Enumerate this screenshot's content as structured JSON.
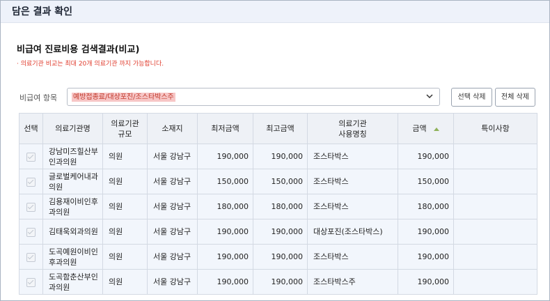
{
  "header": {
    "title": "담은 결과 확인"
  },
  "section": {
    "title": "비급여 진료비용 검색결과(비교)",
    "notice": "· 의료기관 비교는 최대 20개 의료기관 까지 가능합니다."
  },
  "filter": {
    "label": "비급여 항목",
    "selected": "예방접종료/대상포진/조스타박스주",
    "delete_selected_label": "선택 삭제",
    "delete_all_label": "전체 삭제"
  },
  "table": {
    "columns": [
      "선택",
      "의료기관명",
      "의료기관\n규모",
      "소재지",
      "최저금액",
      "최고금액",
      "의료기관\n사용명칭",
      "금액",
      "특이사항"
    ],
    "rows": [
      {
        "name": "강남미즈힐산부인과의원",
        "size": "의원",
        "location": "서울 강남구",
        "min": "190,000",
        "max": "190,000",
        "usage_name": "조스타박스",
        "price": "190,000",
        "note": ""
      },
      {
        "name": "글로벌케어내과의원",
        "size": "의원",
        "location": "서울 강남구",
        "min": "150,000",
        "max": "150,000",
        "usage_name": "조스타박스",
        "price": "150,000",
        "note": ""
      },
      {
        "name": "김용재이비인후과의원",
        "size": "의원",
        "location": "서울 강남구",
        "min": "180,000",
        "max": "180,000",
        "usage_name": "조스타박스",
        "price": "180,000",
        "note": ""
      },
      {
        "name": "김태욱외과의원",
        "size": "의원",
        "location": "서울 강남구",
        "min": "190,000",
        "max": "190,000",
        "usage_name": "대상포진(조스타박스)",
        "price": "190,000",
        "note": ""
      },
      {
        "name": "도곡예원이비인후과의원",
        "size": "의원",
        "location": "서울 강남구",
        "min": "190,000",
        "max": "190,000",
        "usage_name": "조스타박스",
        "price": "190,000",
        "note": ""
      },
      {
        "name": "도곡함춘산부인과의원",
        "size": "의원",
        "location": "서울 강남구",
        "min": "190,000",
        "max": "190,000",
        "usage_name": "조스타박스주",
        "price": "190,000",
        "note": ""
      }
    ]
  },
  "colors": {
    "accent": "#e03b2c",
    "header_bg": "#eef2fa",
    "sort_arrow": "#8fb25a"
  }
}
